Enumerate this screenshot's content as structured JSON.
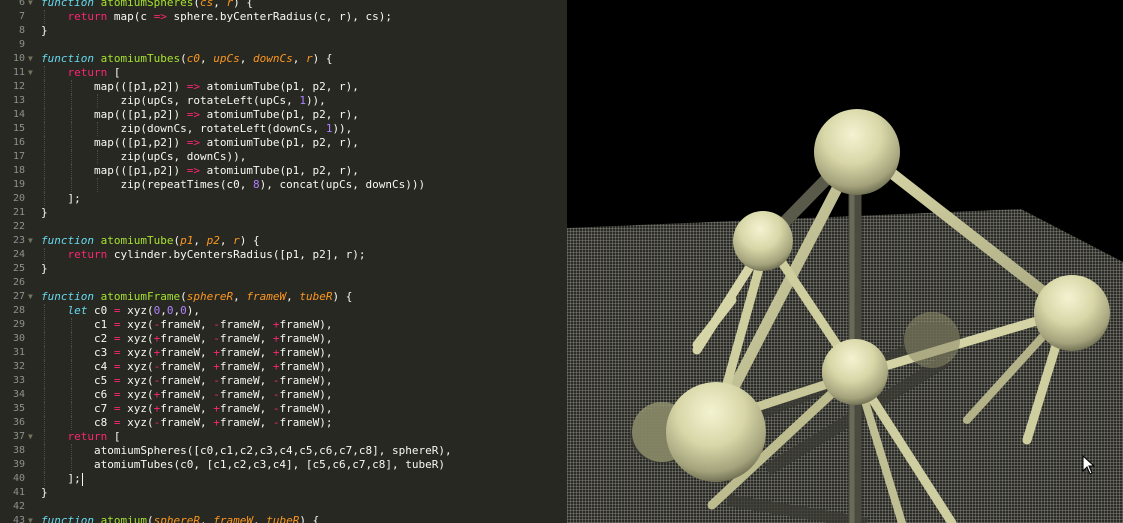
{
  "editor": {
    "lines": [
      {
        "n": "6",
        "fold": "▼",
        "indent": 0,
        "t": [
          [
            "k",
            "function"
          ],
          [
            "",
            " "
          ],
          [
            "fn",
            "atomiumSpheres"
          ],
          [
            "",
            "("
          ],
          [
            "pa",
            "cs"
          ],
          [
            "",
            ", "
          ],
          [
            "pa",
            "r"
          ],
          [
            "",
            ") {"
          ]
        ]
      },
      {
        "n": "7",
        "fold": "",
        "indent": 1,
        "t": [
          [
            "kw",
            "return"
          ],
          [
            "",
            " map(c "
          ],
          [
            "op",
            "=>"
          ],
          [
            "",
            " sphere.byCenterRadius(c, r), cs);"
          ]
        ]
      },
      {
        "n": "8",
        "fold": "",
        "indent": 0,
        "t": [
          [
            "",
            "}"
          ]
        ]
      },
      {
        "n": "9",
        "fold": "",
        "indent": 0,
        "t": []
      },
      {
        "n": "10",
        "fold": "▼",
        "indent": 0,
        "t": [
          [
            "k",
            "function"
          ],
          [
            "",
            " "
          ],
          [
            "fn",
            "atomiumTubes"
          ],
          [
            "",
            "("
          ],
          [
            "pa",
            "c0"
          ],
          [
            "",
            ", "
          ],
          [
            "pa",
            "upCs"
          ],
          [
            "",
            ", "
          ],
          [
            "pa",
            "downCs"
          ],
          [
            "",
            ", "
          ],
          [
            "pa",
            "r"
          ],
          [
            "",
            ") {"
          ]
        ]
      },
      {
        "n": "11",
        "fold": "▼",
        "indent": 1,
        "t": [
          [
            "kw",
            "return"
          ],
          [
            "",
            " ["
          ]
        ]
      },
      {
        "n": "12",
        "fold": "",
        "indent": 2,
        "t": [
          [
            "",
            "map(([p1,p2]) "
          ],
          [
            "op",
            "=>"
          ],
          [
            "",
            " atomiumTube(p1, p2, r),"
          ]
        ]
      },
      {
        "n": "13",
        "fold": "",
        "indent": 3,
        "t": [
          [
            "",
            "zip(upCs, rotateLeft(upCs, "
          ],
          [
            "nu",
            "1"
          ],
          [
            "",
            ")),"
          ]
        ]
      },
      {
        "n": "14",
        "fold": "",
        "indent": 2,
        "t": [
          [
            "",
            "map(([p1,p2]) "
          ],
          [
            "op",
            "=>"
          ],
          [
            "",
            " atomiumTube(p1, p2, r),"
          ]
        ]
      },
      {
        "n": "15",
        "fold": "",
        "indent": 3,
        "t": [
          [
            "",
            "zip(downCs, rotateLeft(downCs, "
          ],
          [
            "nu",
            "1"
          ],
          [
            "",
            ")),"
          ]
        ]
      },
      {
        "n": "16",
        "fold": "",
        "indent": 2,
        "t": [
          [
            "",
            "map(([p1,p2]) "
          ],
          [
            "op",
            "=>"
          ],
          [
            "",
            " atomiumTube(p1, p2, r),"
          ]
        ]
      },
      {
        "n": "17",
        "fold": "",
        "indent": 3,
        "t": [
          [
            "",
            "zip(upCs, downCs)),"
          ]
        ]
      },
      {
        "n": "18",
        "fold": "",
        "indent": 2,
        "t": [
          [
            "",
            "map(([p1,p2]) "
          ],
          [
            "op",
            "=>"
          ],
          [
            "",
            " atomiumTube(p1, p2, r),"
          ]
        ]
      },
      {
        "n": "19",
        "fold": "",
        "indent": 3,
        "t": [
          [
            "",
            "zip(repeatTimes(c0, "
          ],
          [
            "nu",
            "8"
          ],
          [
            "",
            "), concat(upCs, downCs)))"
          ]
        ]
      },
      {
        "n": "20",
        "fold": "",
        "indent": 1,
        "t": [
          [
            "",
            "];"
          ]
        ]
      },
      {
        "n": "21",
        "fold": "",
        "indent": 0,
        "t": [
          [
            "",
            "}"
          ]
        ]
      },
      {
        "n": "22",
        "fold": "",
        "indent": 0,
        "t": []
      },
      {
        "n": "23",
        "fold": "▼",
        "indent": 0,
        "t": [
          [
            "k",
            "function"
          ],
          [
            "",
            " "
          ],
          [
            "fn",
            "atomiumTube"
          ],
          [
            "",
            "("
          ],
          [
            "pa",
            "p1"
          ],
          [
            "",
            ", "
          ],
          [
            "pa",
            "p2"
          ],
          [
            "",
            ", "
          ],
          [
            "pa",
            "r"
          ],
          [
            "",
            ") {"
          ]
        ]
      },
      {
        "n": "24",
        "fold": "",
        "indent": 1,
        "t": [
          [
            "kw",
            "return"
          ],
          [
            "",
            " cylinder.byCentersRadius([p1, p2], r);"
          ]
        ]
      },
      {
        "n": "25",
        "fold": "",
        "indent": 0,
        "t": [
          [
            "",
            "}"
          ]
        ]
      },
      {
        "n": "26",
        "fold": "",
        "indent": 0,
        "t": []
      },
      {
        "n": "27",
        "fold": "▼",
        "indent": 0,
        "t": [
          [
            "k",
            "function"
          ],
          [
            "",
            " "
          ],
          [
            "fn",
            "atomiumFrame"
          ],
          [
            "",
            "("
          ],
          [
            "pa",
            "sphereR"
          ],
          [
            "",
            ", "
          ],
          [
            "pa",
            "frameW"
          ],
          [
            "",
            ", "
          ],
          [
            "pa",
            "tubeR"
          ],
          [
            "",
            ") {"
          ]
        ]
      },
      {
        "n": "28",
        "fold": "",
        "indent": 1,
        "t": [
          [
            "k",
            "let"
          ],
          [
            "",
            " c0 "
          ],
          [
            "op",
            "="
          ],
          [
            "",
            " xyz("
          ],
          [
            "nu",
            "0"
          ],
          [
            "",
            ","
          ],
          [
            "nu",
            "0"
          ],
          [
            "",
            ","
          ],
          [
            "nu",
            "0"
          ],
          [
            "",
            "),"
          ]
        ]
      },
      {
        "n": "29",
        "fold": "",
        "indent": 2,
        "t": [
          [
            "",
            "c1 "
          ],
          [
            "op",
            "="
          ],
          [
            "",
            " xyz("
          ],
          [
            "op",
            "-"
          ],
          [
            "",
            "frameW, "
          ],
          [
            "op",
            "-"
          ],
          [
            "",
            "frameW, "
          ],
          [
            "op",
            "+"
          ],
          [
            "",
            "frameW),"
          ]
        ]
      },
      {
        "n": "30",
        "fold": "",
        "indent": 2,
        "t": [
          [
            "",
            "c2 "
          ],
          [
            "op",
            "="
          ],
          [
            "",
            " xyz("
          ],
          [
            "op",
            "+"
          ],
          [
            "",
            "frameW, "
          ],
          [
            "op",
            "-"
          ],
          [
            "",
            "frameW, "
          ],
          [
            "op",
            "+"
          ],
          [
            "",
            "frameW),"
          ]
        ]
      },
      {
        "n": "31",
        "fold": "",
        "indent": 2,
        "t": [
          [
            "",
            "c3 "
          ],
          [
            "op",
            "="
          ],
          [
            "",
            " xyz("
          ],
          [
            "op",
            "+"
          ],
          [
            "",
            "frameW, "
          ],
          [
            "op",
            "+"
          ],
          [
            "",
            "frameW, "
          ],
          [
            "op",
            "+"
          ],
          [
            "",
            "frameW),"
          ]
        ]
      },
      {
        "n": "32",
        "fold": "",
        "indent": 2,
        "t": [
          [
            "",
            "c4 "
          ],
          [
            "op",
            "="
          ],
          [
            "",
            " xyz("
          ],
          [
            "op",
            "-"
          ],
          [
            "",
            "frameW, "
          ],
          [
            "op",
            "+"
          ],
          [
            "",
            "frameW, "
          ],
          [
            "op",
            "+"
          ],
          [
            "",
            "frameW),"
          ]
        ]
      },
      {
        "n": "33",
        "fold": "",
        "indent": 2,
        "t": [
          [
            "",
            "c5 "
          ],
          [
            "op",
            "="
          ],
          [
            "",
            " xyz("
          ],
          [
            "op",
            "-"
          ],
          [
            "",
            "frameW, "
          ],
          [
            "op",
            "-"
          ],
          [
            "",
            "frameW, "
          ],
          [
            "op",
            "-"
          ],
          [
            "",
            "frameW),"
          ]
        ]
      },
      {
        "n": "34",
        "fold": "",
        "indent": 2,
        "t": [
          [
            "",
            "c6 "
          ],
          [
            "op",
            "="
          ],
          [
            "",
            " xyz("
          ],
          [
            "op",
            "+"
          ],
          [
            "",
            "frameW, "
          ],
          [
            "op",
            "-"
          ],
          [
            "",
            "frameW, "
          ],
          [
            "op",
            "-"
          ],
          [
            "",
            "frameW),"
          ]
        ]
      },
      {
        "n": "35",
        "fold": "",
        "indent": 2,
        "t": [
          [
            "",
            "c7 "
          ],
          [
            "op",
            "="
          ],
          [
            "",
            " xyz("
          ],
          [
            "op",
            "+"
          ],
          [
            "",
            "frameW, "
          ],
          [
            "op",
            "+"
          ],
          [
            "",
            "frameW, "
          ],
          [
            "op",
            "-"
          ],
          [
            "",
            "frameW),"
          ]
        ]
      },
      {
        "n": "36",
        "fold": "",
        "indent": 2,
        "t": [
          [
            "",
            "c8 "
          ],
          [
            "op",
            "="
          ],
          [
            "",
            " xyz("
          ],
          [
            "op",
            "-"
          ],
          [
            "",
            "frameW, "
          ],
          [
            "op",
            "+"
          ],
          [
            "",
            "frameW, "
          ],
          [
            "op",
            "-"
          ],
          [
            "",
            "frameW);"
          ]
        ]
      },
      {
        "n": "37",
        "fold": "▼",
        "indent": 1,
        "t": [
          [
            "kw",
            "return"
          ],
          [
            "",
            " ["
          ]
        ]
      },
      {
        "n": "38",
        "fold": "",
        "indent": 2,
        "t": [
          [
            "",
            "atomiumSpheres([c0,c1,c2,c3,c4,c5,c6,c7,c8], sphereR),"
          ]
        ]
      },
      {
        "n": "39",
        "fold": "",
        "indent": 2,
        "t": [
          [
            "",
            "atomiumTubes(c0, [c1,c2,c3,c4], [c5,c6,c7,c8], tubeR)"
          ]
        ]
      },
      {
        "n": "40",
        "fold": "",
        "indent": 1,
        "t": [
          [
            "",
            "];"
          ]
        ]
      },
      {
        "n": "41",
        "fold": "",
        "indent": 0,
        "t": [
          [
            "",
            "}"
          ]
        ]
      },
      {
        "n": "42",
        "fold": "",
        "indent": 0,
        "t": []
      },
      {
        "n": "43",
        "fold": "▼",
        "indent": 0,
        "t": [
          [
            "k",
            "function"
          ],
          [
            "",
            " "
          ],
          [
            "fn",
            "atomium"
          ],
          [
            "",
            "("
          ],
          [
            "pa",
            "sphereR"
          ],
          [
            "",
            ", "
          ],
          [
            "pa",
            "frameW"
          ],
          [
            "",
            ", "
          ],
          [
            "pa",
            "tubeR"
          ],
          [
            "",
            ") {"
          ]
        ]
      }
    ]
  },
  "viewport": {
    "model_color": "#e0dfb0",
    "floor_color": "#8a8a80",
    "background": "#000000"
  },
  "icons": {
    "cursor": "mouse-pointer-icon",
    "fold": "fold-arrow-icon"
  }
}
